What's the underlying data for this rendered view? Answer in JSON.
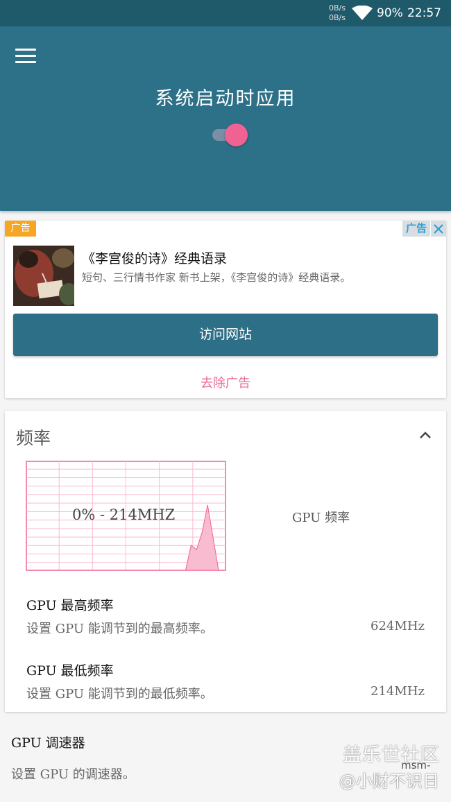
{
  "status_bar": {
    "net_up": "0B/s",
    "net_down": "0B/s",
    "battery": "90%",
    "time": "22:57",
    "wifi_icon": "wifi-icon"
  },
  "header": {
    "menu_icon": "hamburger-menu-icon",
    "title": "系统启动时应用",
    "toggle_on": true,
    "accent_color": "#f06292",
    "bg_color": "#2d7189"
  },
  "ad": {
    "tag_left": "广告",
    "tag_right": "广告",
    "close_icon": "close-icon",
    "title": "《李宫俊的诗》经典语录",
    "description": "短句、三行情书作家 新书上架，《李宫俊的诗》经典语录。",
    "visit_button": "访问网站",
    "remove_ad": "去除广告"
  },
  "frequency": {
    "title": "频率",
    "collapse_icon": "chevron-up-icon",
    "graph_label": "0% - 214MHZ",
    "gpu_freq_label": "GPU 频率",
    "graph_color": "#f06292",
    "graph_load": [
      0,
      0,
      0,
      0,
      0,
      0,
      0,
      0,
      0,
      0,
      0,
      0,
      0,
      0,
      0,
      0,
      0,
      0,
      0,
      0,
      0,
      0,
      0,
      0,
      0,
      0,
      0,
      0,
      0,
      0,
      0.23,
      0.19,
      0.35,
      0.6,
      0.3,
      0
    ],
    "max_freq": {
      "title": "GPU 最高频率",
      "summary": "设置 GPU 能调节到的最高频率。",
      "value": "624MHz"
    },
    "min_freq": {
      "title": "GPU 最低频率",
      "summary": "设置 GPU 能调节到的最低频率。",
      "value": "214MHz"
    }
  },
  "governor": {
    "title": "GPU 调速器",
    "summary": "设置 GPU 的调速器。"
  },
  "watermark": {
    "main": "盖乐世社区",
    "user": "msm-",
    "sub": "@小财不识日"
  }
}
